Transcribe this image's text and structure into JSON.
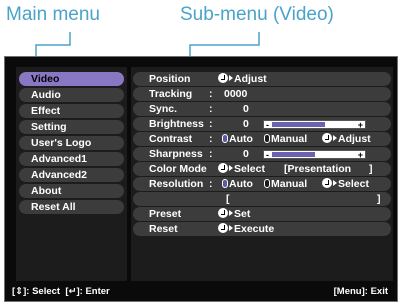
{
  "callouts": {
    "main_menu": "Main menu",
    "sub_menu": "Sub-menu (Video)"
  },
  "main_menu": {
    "selected": "Video",
    "items": [
      "Video",
      "Audio",
      "Effect",
      "Setting",
      "User's Logo",
      "Advanced1",
      "Advanced2",
      "About",
      "Reset All"
    ]
  },
  "sub_menu": {
    "position": {
      "label": "Position",
      "action": "Adjust",
      "icon": "enter-icon"
    },
    "tracking": {
      "label": "Tracking",
      "sep": ":",
      "value": "0000"
    },
    "sync": {
      "label": "Sync.",
      "sep": ":",
      "value": "0"
    },
    "brightness": {
      "label": "Brightness",
      "sep": ":",
      "value": "0",
      "minus": "-",
      "plus": "+",
      "level": 0.62
    },
    "contrast": {
      "label": "Contrast",
      "sep": ":",
      "opt_auto": "Auto",
      "opt_manual": "Manual",
      "action": "Adjust",
      "selected": "Auto"
    },
    "sharpness": {
      "label": "Sharpness",
      "sep": ":",
      "value": "0",
      "minus": "-",
      "plus": "+",
      "level": 0.5
    },
    "color_mode": {
      "label": "Color Mode",
      "action": "Select",
      "value": "[Presentation",
      "close": "]"
    },
    "resolution": {
      "label": "Resolution",
      "sep": ":",
      "opt_auto": "Auto",
      "opt_manual": "Manual",
      "action": "Select",
      "selected": "Auto"
    },
    "bracket_row": {
      "open": "[",
      "close": "]"
    },
    "preset": {
      "label": "Preset",
      "action": "Set"
    },
    "reset": {
      "label": "Reset",
      "action": "Execute"
    }
  },
  "status_bar": {
    "select_hint": "[⇕]: Select",
    "enter_hint": "[↵]: Enter",
    "exit_hint": "[Menu]: Exit"
  }
}
